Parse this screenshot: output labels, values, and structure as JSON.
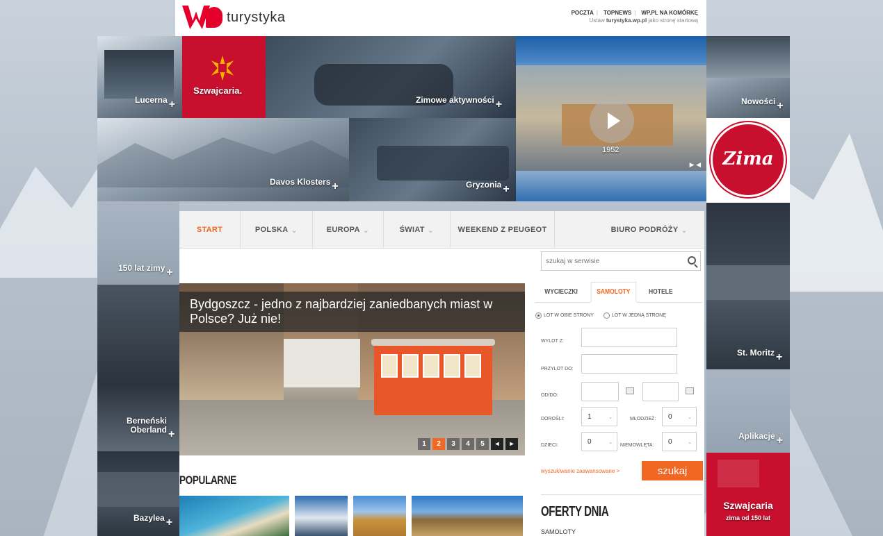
{
  "header": {
    "logo_text": "turystyka",
    "links": [
      "POCZTA",
      "TOPNEWS",
      "WP.PL NA KOMÓRKĘ"
    ],
    "homepage_prefix": "Ustaw",
    "homepage_site": "turystyka.wp.pl",
    "homepage_suffix": "jako stronę startową"
  },
  "tiles": {
    "lucerna": "Lucerna",
    "szwajcaria_brand": "Szwajcaria.",
    "zimowe": "Zimowe aktywności",
    "video_year": "1952",
    "nowosci": "Nowości",
    "davos": "Davos Klosters",
    "gryzonia": "Gryzonia",
    "zima_badge": "Zima",
    "lat150": "150 lat zimy",
    "st_moritz": "St. Moritz",
    "bernenski": "Berneński Oberland",
    "aplikacje": "Aplikacje",
    "bazylea": "Bazylea",
    "promo_title": "Szwajcaria",
    "promo_sub": "zima od 150 lat"
  },
  "nav": {
    "start": "START",
    "polska": "POLSKA",
    "europa": "EUROPA",
    "swiat": "ŚWIAT",
    "weekend": "WEEKEND Z PEUGEOT",
    "biuro": "BIURO PODRÓŻY"
  },
  "search": {
    "placeholder": "szukaj w serwisie"
  },
  "hero": {
    "caption": "Bydgoszcz - jedno z najbardziej zaniedbanych miast w Polsce? Już nie!",
    "pages": [
      "1",
      "2",
      "3",
      "4",
      "5"
    ],
    "active_page": "2"
  },
  "popular": {
    "title": "POPULARNE"
  },
  "booking": {
    "tabs": [
      "WYCIECZKI",
      "SAMOLOTY",
      "HOTELE"
    ],
    "active_tab": "SAMOLOTY",
    "radio_both": "LOT W OBIE STRONY",
    "radio_one": "LOT W JEDNĄ STRONĘ",
    "wylot": "WYLOT Z:",
    "przylot": "PRZYLOT DO:",
    "oddo": "OD/DO:",
    "dorosli": "DOROŚLI:",
    "dorosli_val": "1",
    "mlodziez": "MŁODZIEŻ:",
    "mlodziez_val": "0",
    "dzieci": "DZIECI:",
    "dzieci_val": "0",
    "niemowleta": "NIEMOWLĘTA:",
    "niemowleta_val": "0",
    "advanced": "wyszukiwanie zaawansowane >",
    "submit": "szukaj"
  },
  "oferty": {
    "title": "OFERTY DNIA",
    "sub": "SAMOLOTY"
  },
  "colors": {
    "accent": "#f26722",
    "brand_red": "#e4002b",
    "swiss_red": "#c8102e"
  }
}
